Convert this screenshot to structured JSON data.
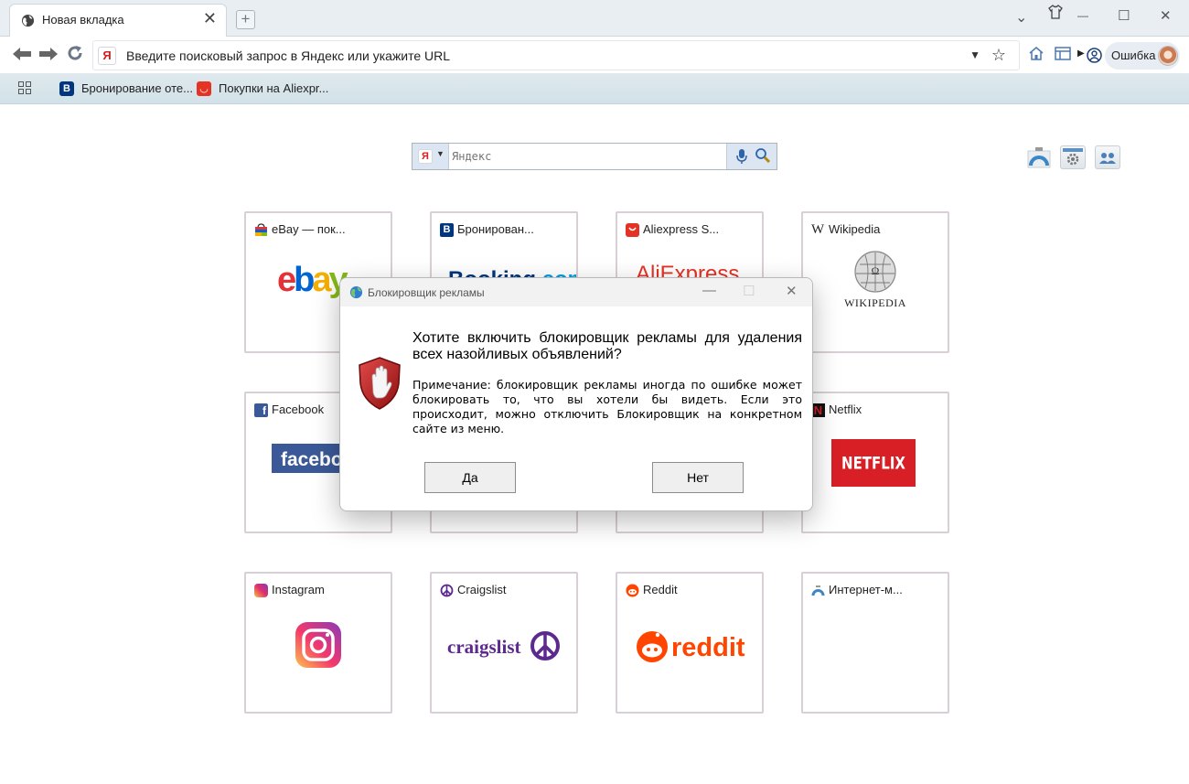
{
  "browser": {
    "tab": {
      "title": "Новая вкладка",
      "close": "✕"
    },
    "window_controls": {
      "tabs_list": "⌄",
      "theme": "👕",
      "minimize": "—",
      "maximize": "☐",
      "close": "✕"
    },
    "nav": {
      "back": "⬅",
      "forward": "➡",
      "reload": "↻"
    },
    "url_placeholder": "Введите поисковый запрос в Яндекс или укажите URL",
    "url_engine_badge": "Я",
    "profile_label": "Ошибка",
    "bookmarks": [
      {
        "label": "Бронирование оте...",
        "icon": "B",
        "color": "#003580"
      },
      {
        "label": "Покупки на Aliexpr...",
        "icon": "◡",
        "color": "#e43225"
      }
    ]
  },
  "page": {
    "search": {
      "engine_badge": "Я",
      "placeholder": "Яндекс"
    },
    "tiles": [
      {
        "title": "eBay — пок...",
        "logo": "ebay"
      },
      {
        "title": "Бронирован...",
        "logo": "Booking.com"
      },
      {
        "title": "Aliexpress S...",
        "logo": "AliExpress"
      },
      {
        "title": "Wikipedia",
        "logo": "Wikipedia",
        "logo_sub": "WIKIPEDIA"
      },
      {
        "title": "Facebook",
        "logo": "facebook"
      },
      {
        "title": "",
        "logo": ""
      },
      {
        "title": "",
        "logo": ""
      },
      {
        "title": "Netflix",
        "logo": "NETFLIX"
      },
      {
        "title": "Instagram",
        "logo": "instagram"
      },
      {
        "title": "Craigslist",
        "logo": "craigslist"
      },
      {
        "title": "Reddit",
        "logo": "reddit"
      },
      {
        "title": "Интернет-м...",
        "logo": ""
      }
    ]
  },
  "dialog": {
    "title": "Блокировщик рекламы",
    "heading": "Хотите включить блокировщик рекламы для удаления всех назойливых объявлений?",
    "note": "Примечание: блокировщик рекламы иногда по ошибке может блокировать то, что вы хотели бы видеть. Если это происходит, можно отключить Блокировщик на конкретном сайте из меню.",
    "yes_label": "Да",
    "no_label": "Нет",
    "controls": {
      "minimize": "—",
      "maximize": "☐",
      "close": "✕"
    }
  },
  "colors": {
    "chrome_bg": "#e9eef3",
    "bookmarks_bg": "#d6e4ea",
    "tile_border": "#d9cfd6",
    "ebay": [
      "#e53238",
      "#0064d2",
      "#f5af02",
      "#86b817"
    ],
    "facebook": "#3b5998",
    "netflix": "#d81f26",
    "reddit": "#ff4500",
    "craigslist": "#5c2a8f"
  },
  "icons": [
    "globe-icon",
    "back-arrow-icon",
    "forward-arrow-icon",
    "reload-icon",
    "star-icon",
    "home-icon",
    "sidebar-icon",
    "profile-icon",
    "apps-grid-icon",
    "microphone-icon",
    "magnifier-icon",
    "stop-hand-shield-icon"
  ]
}
